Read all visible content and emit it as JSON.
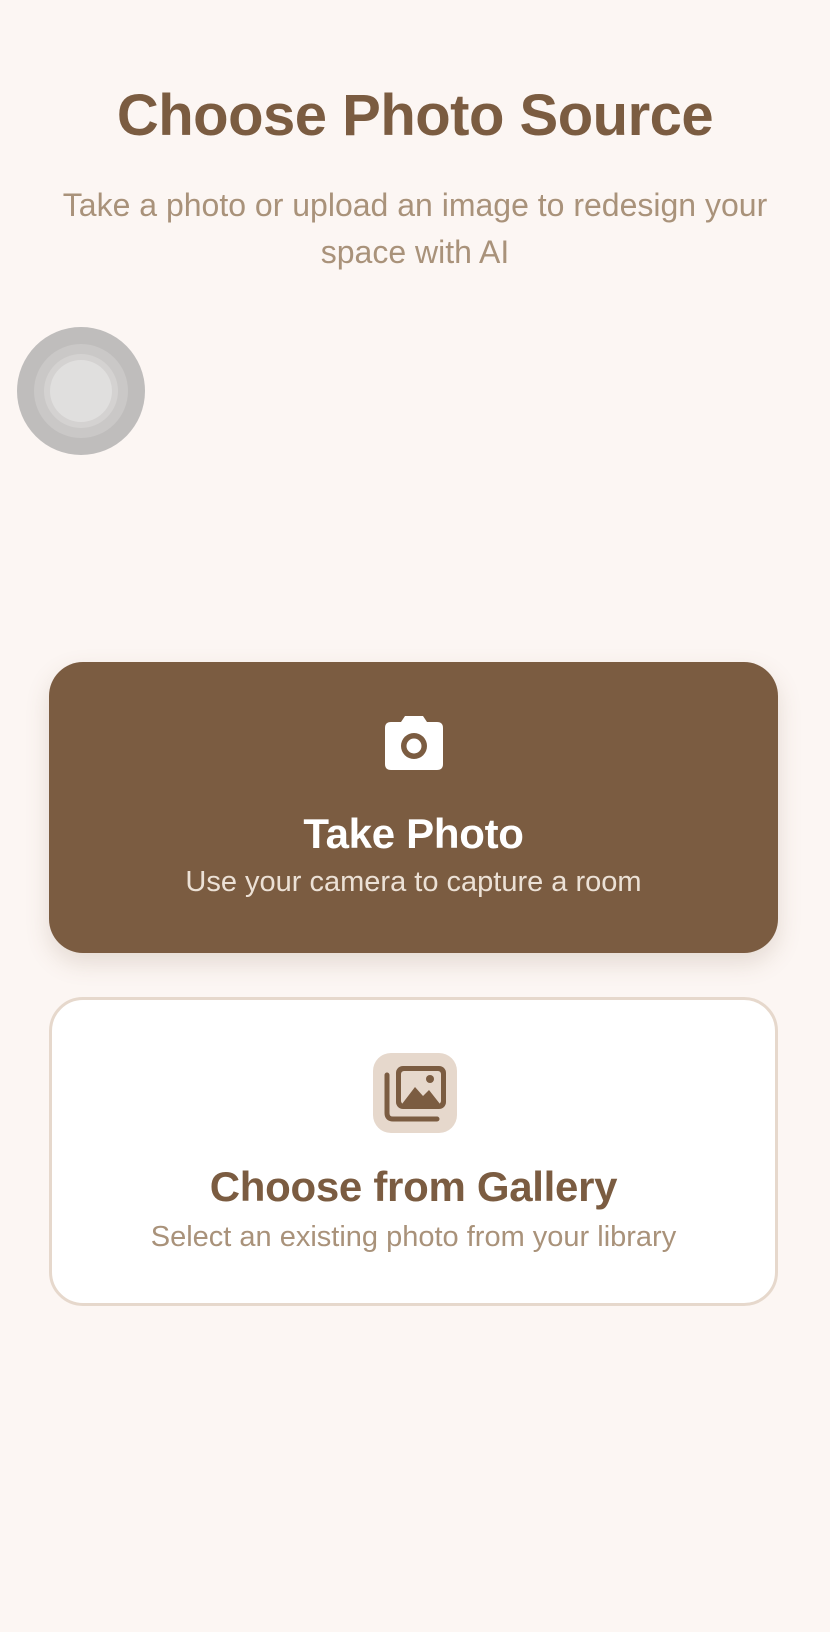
{
  "header": {
    "title": "Choose Photo Source",
    "subtitle": "Take a photo or upload an image to redesign your space with AI"
  },
  "options": {
    "camera": {
      "title": "Take Photo",
      "description": "Use your camera to capture a room",
      "icon": "camera-icon"
    },
    "gallery": {
      "title": "Choose from Gallery",
      "description": "Select an existing photo from your library",
      "icon": "photo-library-icon"
    }
  },
  "colors": {
    "background": "#fcf6f3",
    "primary": "#7b5c41",
    "secondary_text": "#a9927a",
    "card_border": "#e6d8cc",
    "white": "#ffffff"
  }
}
